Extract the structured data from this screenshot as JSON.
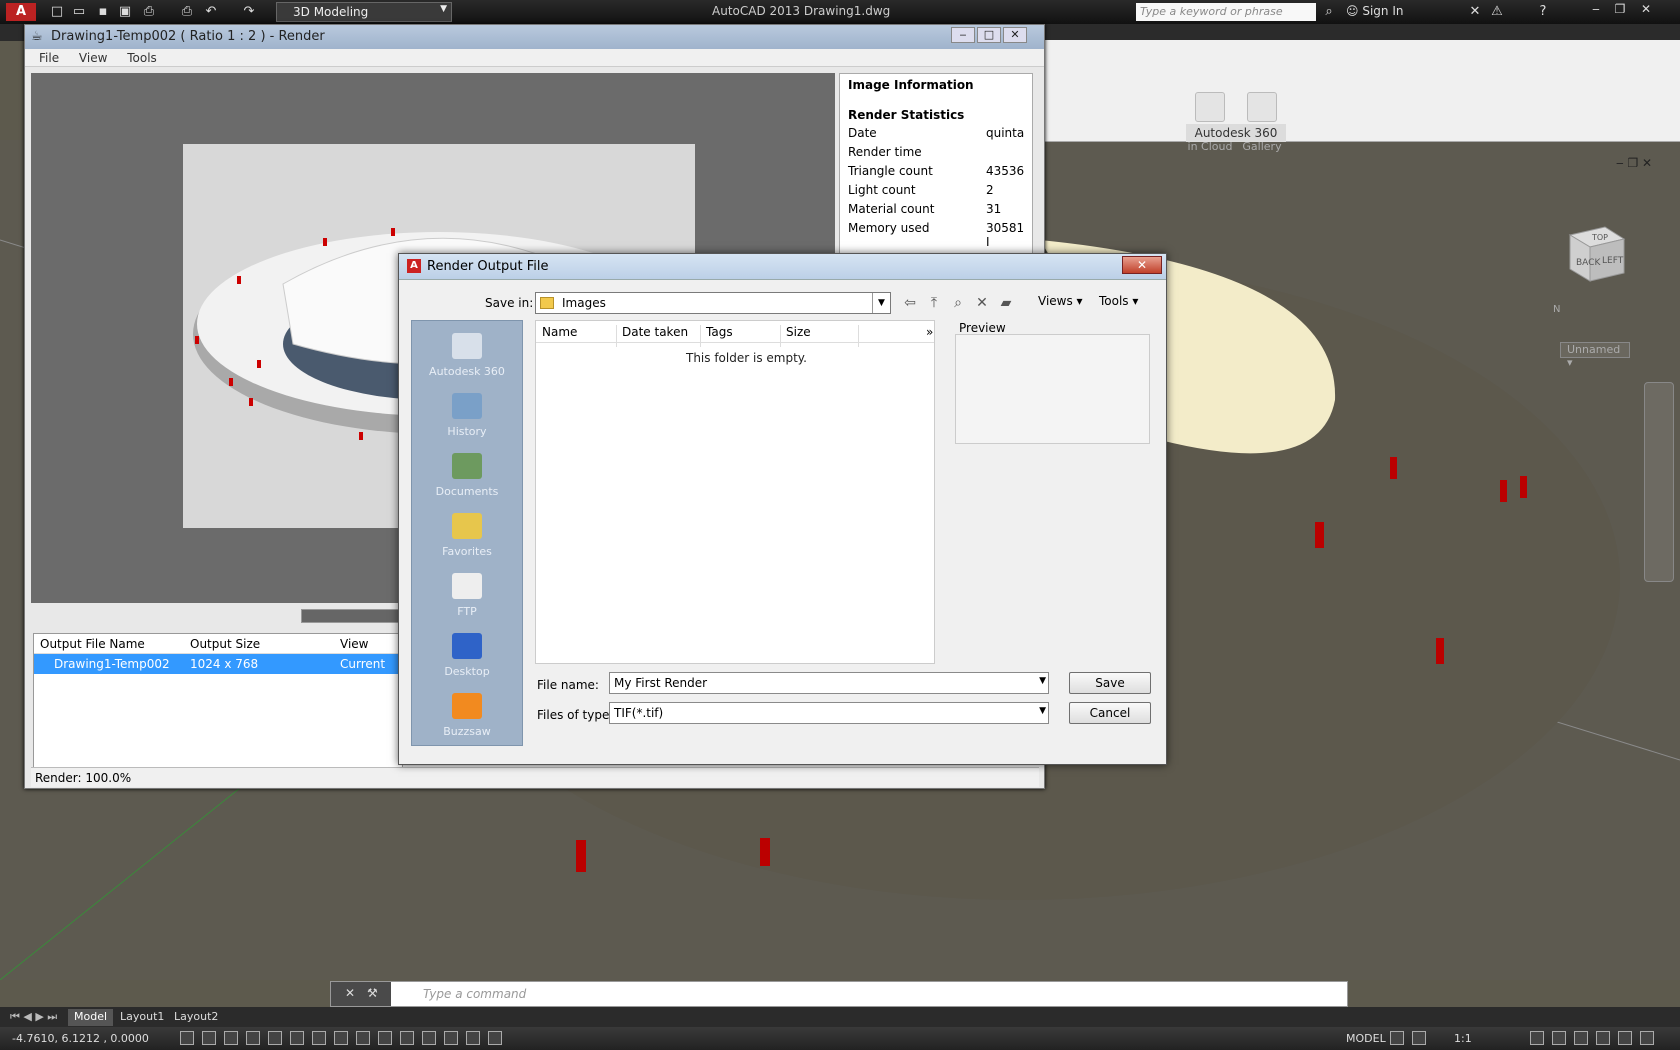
{
  "app": {
    "title": "AutoCAD 2013    Drawing1.dwg",
    "workspace": "3D Modeling",
    "search_placeholder": "Type a keyword or phrase",
    "sign_in": "Sign In"
  },
  "ribbon": {
    "render_in_cloud": "Render in Cloud",
    "render_gallery": "Render Gallery",
    "panel_title": "Autodesk 360"
  },
  "viewport": {
    "view_name": "Unnamed",
    "cube_top": "TOP",
    "cube_back": "BACK",
    "cube_left": "LEFT",
    "compass_n": "N"
  },
  "render_window": {
    "title": "Drawing1-Temp002   ( Ratio 1 : 2 ) - Render",
    "menu": [
      "File",
      "View",
      "Tools"
    ],
    "info_header": "Image Information",
    "stats_header": "Render Statistics",
    "stats": [
      {
        "label": "Date",
        "value": "quinta"
      },
      {
        "label": "Render time",
        "value": ""
      },
      {
        "label": "Triangle count",
        "value": "43536"
      },
      {
        "label": "Light count",
        "value": "2"
      },
      {
        "label": "Material count",
        "value": "31"
      },
      {
        "label": "Memory used",
        "value": "30581 I"
      }
    ],
    "history_headers": [
      "Output File Name",
      "Output Size",
      "View"
    ],
    "history_row": {
      "name": "Drawing1-Temp002",
      "size": "1024 x 768",
      "view": "Current"
    },
    "status": "Render: 100.0%"
  },
  "dialog": {
    "title": "Render Output File",
    "save_in_label": "Save in:",
    "save_in_value": "Images",
    "views": "Views",
    "tools": "Tools",
    "places": [
      "Autodesk 360",
      "History",
      "Documents",
      "Favorites",
      "FTP",
      "Desktop",
      "Buzzsaw"
    ],
    "columns": [
      "Name",
      "Date taken",
      "Tags",
      "Size"
    ],
    "more_columns": "»",
    "empty_text": "This folder is empty.",
    "preview_label": "Preview",
    "file_name_label": "File name:",
    "file_name_value": "My First Render",
    "file_type_label": "Files of type:",
    "file_type_value": "TIF(*.tif)",
    "save_button": "Save",
    "cancel_button": "Cancel"
  },
  "command": {
    "placeholder": "Type  a  command"
  },
  "layout_tabs": [
    "Model",
    "Layout1",
    "Layout2"
  ],
  "status": {
    "coords": "-4.7610, 6.1212  , 0.0000",
    "model": "MODEL",
    "scale": "1:1"
  }
}
